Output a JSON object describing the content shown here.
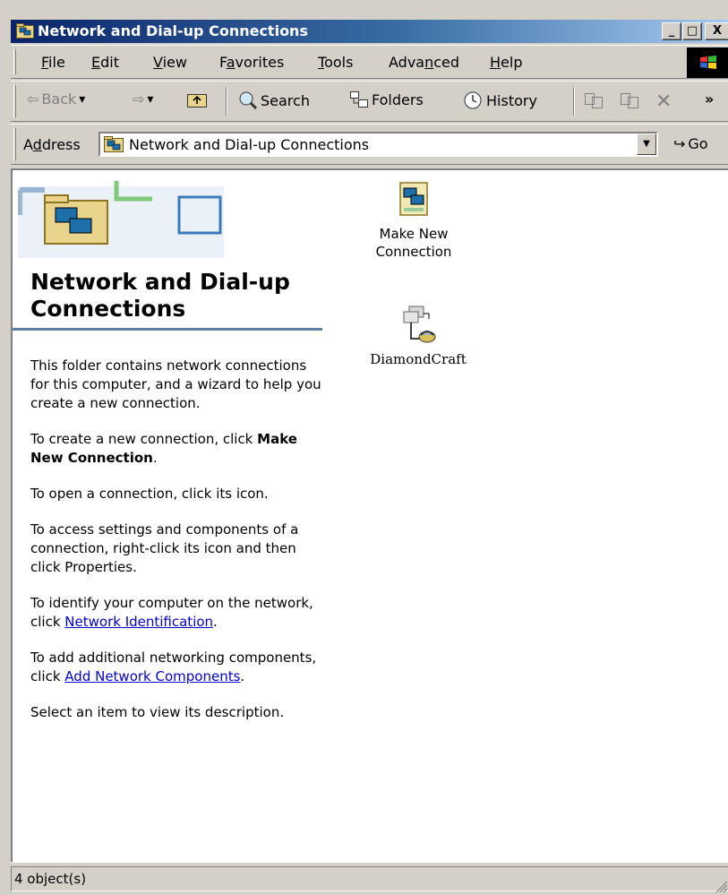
{
  "window": {
    "title": "Network and Dial-up Connections",
    "controls": {
      "minimize": "_",
      "maximize": "□",
      "close": "X"
    }
  },
  "menu": {
    "items": [
      {
        "pre": "",
        "acc": "F",
        "post": "ile"
      },
      {
        "pre": "",
        "acc": "E",
        "post": "dit"
      },
      {
        "pre": "",
        "acc": "V",
        "post": "iew"
      },
      {
        "pre": "F",
        "acc": "a",
        "post": "vorites"
      },
      {
        "pre": "",
        "acc": "T",
        "post": "ools"
      },
      {
        "pre": "Adva",
        "acc": "n",
        "post": "ced"
      },
      {
        "pre": "",
        "acc": "H",
        "post": "elp"
      }
    ]
  },
  "toolbar": {
    "back": "Back",
    "search": "Search",
    "folders": "Folders",
    "history": "History",
    "more": "»"
  },
  "address": {
    "label_pre": "A",
    "label_acc": "d",
    "label_post": "dress",
    "value": "Network and Dial-up Connections",
    "go": "Go"
  },
  "panel": {
    "title": "Network and Dial-up Connections",
    "p1": "This folder contains network connections for this computer, and a wizard to help you create a new connection.",
    "p2_pre": "To create a new connection, click",
    "p2_bold": "Make New Connection",
    "p3": "To open a connection, click its icon.",
    "p4": "To access settings and components of a connection, right-click its icon and then click Properties.",
    "p5_pre": "To identify your computer on the network, click",
    "p5_link": "Network Identification",
    "p6_pre": "To add additional networking components, click",
    "p6_link": "Add Network Components",
    "p7": "Select an item to view its description."
  },
  "icons": {
    "make_new": "Make New Connection",
    "diamondcraft": "DiamondCraft"
  },
  "status": {
    "text": "4 object(s)"
  },
  "colors": {
    "title_start": "#0a246a",
    "title_end": "#a6caf0",
    "link": "#0000cc",
    "rule": "#5b7fa6"
  }
}
